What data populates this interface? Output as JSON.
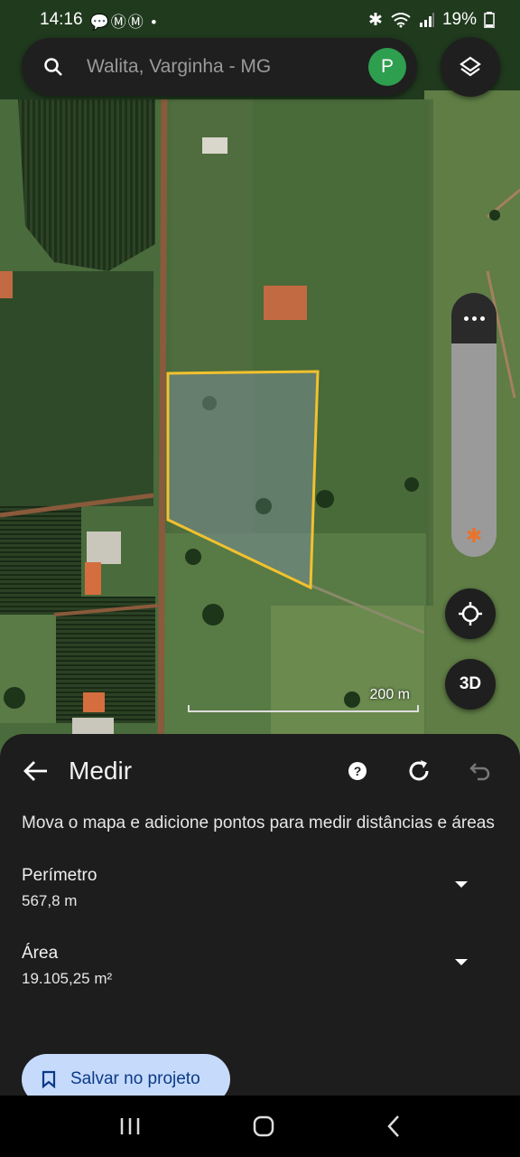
{
  "status_bar": {
    "time": "14:16",
    "notifications": "💬ⓂⓂ •",
    "battery": "19%"
  },
  "search": {
    "placeholder": "Walita, Varginha - MG",
    "avatar_letter": "P"
  },
  "map": {
    "scale_label": "200 m",
    "three_d_label": "3D",
    "polygon_color": "#f2c12e"
  },
  "measure_sheet": {
    "title": "Medir",
    "description": "Mova o mapa e adicione pontos para medir distâncias e áreas",
    "perimeter": {
      "label": "Perímetro",
      "value": "567,8 m"
    },
    "area": {
      "label": "Área",
      "value": "19.105,25 m²"
    },
    "save_button": "Salvar no projeto"
  },
  "icons": [
    "search-icon",
    "layers-icon",
    "more-icon",
    "bluetooth-icon",
    "my-location-icon",
    "back-arrow-icon",
    "help-icon",
    "refresh-icon",
    "undo-icon",
    "bookmark-icon",
    "recent-apps-icon",
    "home-icon",
    "back-icon"
  ]
}
